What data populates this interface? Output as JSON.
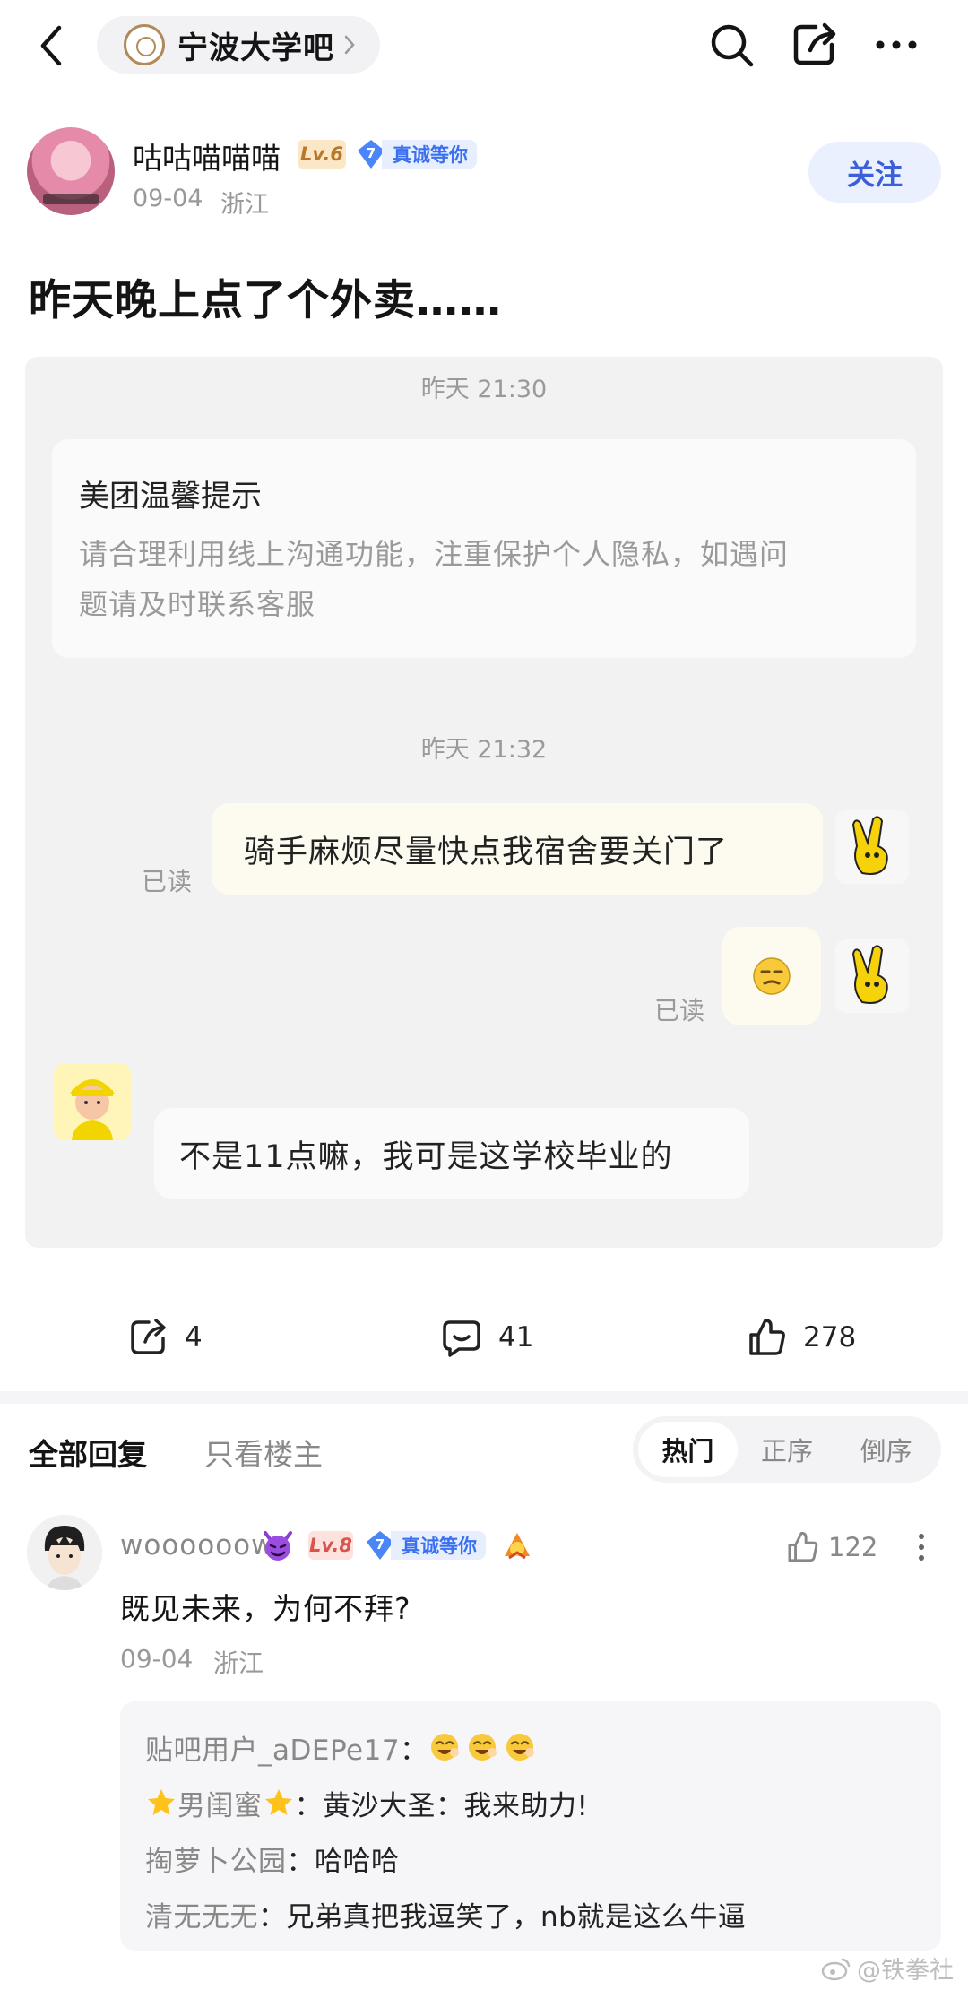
{
  "header": {
    "forum_name": "宁波大学吧"
  },
  "post": {
    "author": {
      "name": "咕咕喵喵喵",
      "level": "Lv.6",
      "badge_level": "7",
      "badge_text": "真诚等你"
    },
    "date": "09-04",
    "location": "浙江",
    "follow_label": "关注",
    "title": "昨天晚上点了个外卖……",
    "image": {
      "time_1": "昨天 21:30",
      "notice_title": "美团温馨提示",
      "notice_line_1": "请合理利用线上沟通功能，注重保护个人隐私，如遇问",
      "notice_line_2": "题请及时联系客服",
      "time_2": "昨天 21:32",
      "msg_1": "骑手麻烦尽量快点我宿舍要关门了",
      "read_label": "已读",
      "msg_3": "不是11点嘛，我可是这学校毕业的"
    },
    "actions": {
      "share_count": "4",
      "comment_count": "41",
      "like_count": "278"
    }
  },
  "tabs": {
    "all": "全部回复",
    "op_only": "只看楼主",
    "sort": [
      "热门",
      "正序",
      "倒序"
    ],
    "active_sort": "热门"
  },
  "reply": {
    "user": "woooooow",
    "level": "Lv.8",
    "badge_level": "7",
    "badge_text": "真诚等你",
    "likes": "122",
    "text": "既见未来，为何不拜?",
    "date": "09-04",
    "location": "浙江",
    "sub_replies": [
      {
        "name": "贴吧用户_aDEPe17",
        "sep": "："
      },
      {
        "name": "男闺蜜",
        "sep": "：",
        "text": "黄沙大圣：我来助力!"
      },
      {
        "name": "掏萝卜公园",
        "sep": "：",
        "text": "哈哈哈"
      },
      {
        "name": "清无无无",
        "sep": "：",
        "text": "兄弟真把我逗笑了，nb就是这么牛逼"
      }
    ]
  },
  "watermark": "@铁拳社",
  "colors": {
    "accent_blue": "#3a5fd9",
    "level_orange": "#b8782a",
    "level_red": "#d9534f"
  }
}
